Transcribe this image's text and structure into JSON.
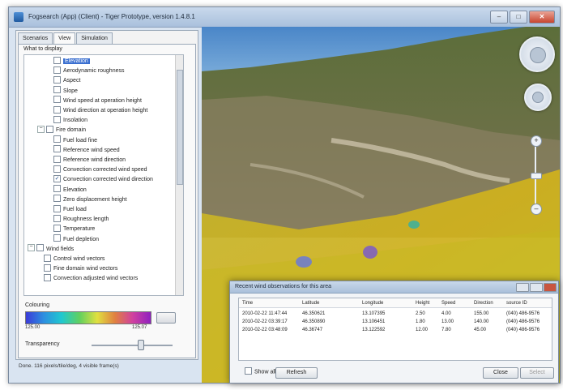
{
  "window": {
    "title": "Fogsearch (App) (Client) - Tiger Prototype, version 1.4.8.1",
    "controls": {
      "minimize": "–",
      "maximize": "□",
      "close": "✕"
    }
  },
  "tabs": [
    {
      "label": "Scenarios"
    },
    {
      "label": "View"
    },
    {
      "label": "Simulation"
    }
  ],
  "panel": {
    "what_to_display": "What to display",
    "tree": [
      {
        "label": "Elevation",
        "type": "item",
        "checked": false,
        "selected": true,
        "indent": 2
      },
      {
        "label": "Aerodynamic roughness",
        "type": "item",
        "checked": false,
        "indent": 2
      },
      {
        "label": "Aspect",
        "type": "item",
        "checked": false,
        "indent": 2
      },
      {
        "label": "Slope",
        "type": "item",
        "checked": false,
        "indent": 2
      },
      {
        "label": "Wind speed at operation height",
        "type": "item",
        "checked": false,
        "indent": 2
      },
      {
        "label": "Wind direction at operation height",
        "type": "item",
        "checked": false,
        "indent": 2
      },
      {
        "label": "Insolation",
        "type": "item",
        "checked": false,
        "indent": 2
      },
      {
        "label": "Fire domain",
        "type": "group",
        "checked": false,
        "indent": 1
      },
      {
        "label": "Fuel load fine",
        "type": "item",
        "checked": false,
        "indent": 2
      },
      {
        "label": "Reference wind speed",
        "type": "item",
        "checked": false,
        "indent": 2
      },
      {
        "label": "Reference wind direction",
        "type": "item",
        "checked": false,
        "indent": 2
      },
      {
        "label": "Convection corrected wind speed",
        "type": "item",
        "checked": false,
        "indent": 2
      },
      {
        "label": "Convection corrected wind direction",
        "type": "item",
        "checked": true,
        "indent": 2
      },
      {
        "label": "Elevation",
        "type": "item",
        "checked": false,
        "indent": 2
      },
      {
        "label": "Zero displacement height",
        "type": "item",
        "checked": false,
        "indent": 2
      },
      {
        "label": "Fuel load",
        "type": "item",
        "checked": false,
        "indent": 2
      },
      {
        "label": "Roughness length",
        "type": "item",
        "checked": false,
        "indent": 2
      },
      {
        "label": "Temperature",
        "type": "item",
        "checked": false,
        "indent": 2
      },
      {
        "label": "Fuel depletion",
        "type": "item",
        "checked": false,
        "indent": 2
      },
      {
        "label": "Wind fields",
        "type": "group",
        "checked": false,
        "indent": 0
      },
      {
        "label": "Control wind vectors",
        "type": "item",
        "checked": false,
        "indent": 1
      },
      {
        "label": "Fine domain wind vectors",
        "type": "item",
        "checked": false,
        "indent": 1
      },
      {
        "label": "Convection adjusted wind vectors",
        "type": "item",
        "checked": false,
        "indent": 1
      }
    ],
    "colouring_label": "Colouring",
    "colour_min": "125.00",
    "colour_max": "125.07",
    "transparency_label": "Transparency",
    "transparency_value": 0.6
  },
  "status": "Done. 116 pixels/tile/deg, 4 visible frame(s)",
  "dialog": {
    "title": "Recent wind observations for this area",
    "columns": [
      "Time",
      "Latitude",
      "Longitude",
      "Height",
      "Speed",
      "Direction",
      "source ID"
    ],
    "rows": [
      [
        "2010-02-22 11:47:44",
        "46.350621",
        "13.107395",
        "2.50",
        "4.00",
        "155.00",
        "(040) 486-9576"
      ],
      [
        "2010-02-22 03:39:17",
        "46.350890",
        "13.106451",
        "1.80",
        "13.00",
        "140.00",
        "(040) 486-9576"
      ],
      [
        "2010-02-22 03:48:09",
        "46.36747",
        "13.122592",
        "12.00",
        "7.80",
        "45.00",
        "(040) 486-9576"
      ]
    ],
    "show_all_label": "Show all",
    "refresh_label": "Refresh",
    "close_label": "Close",
    "select_label": "Select"
  },
  "colors": {
    "accent": "#3a6fd0",
    "terrain_overlay": "#d4b81a"
  },
  "icons": [
    "app-icon",
    "compass-icon",
    "look-icon",
    "zoom-in-icon",
    "zoom-out-icon"
  ]
}
